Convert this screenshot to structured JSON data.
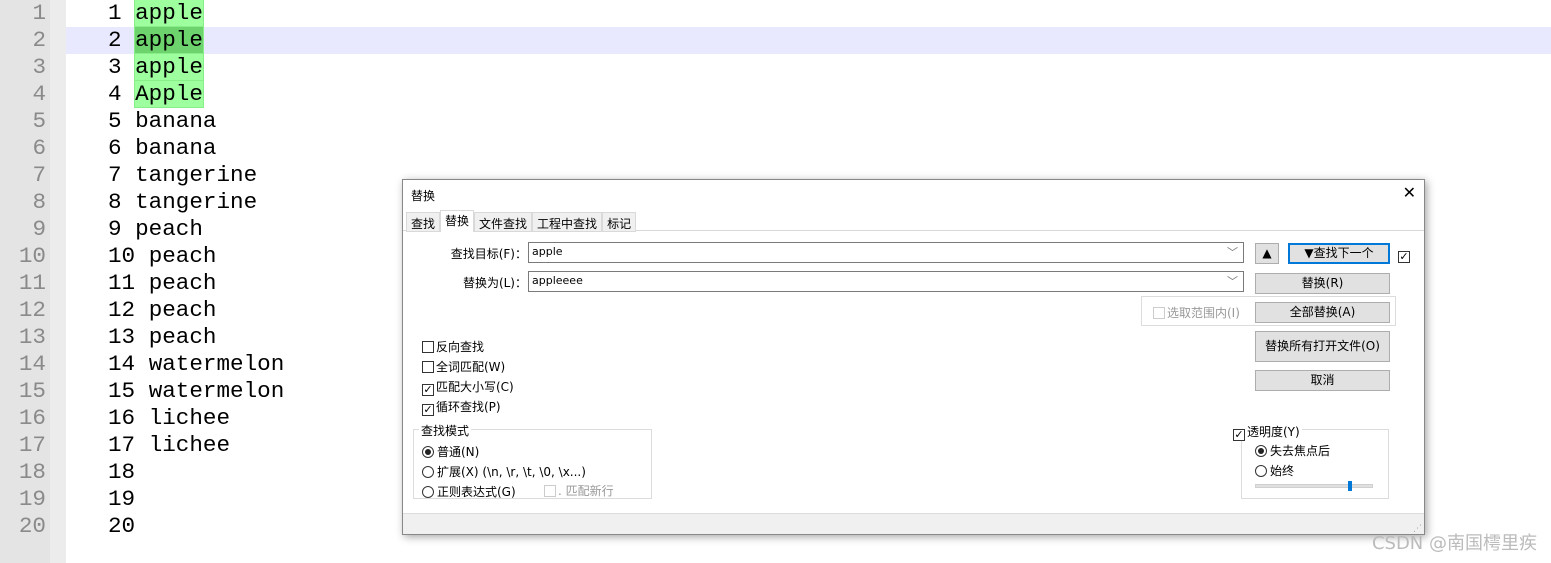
{
  "editor": {
    "lines": [
      {
        "n": "1",
        "num": "1",
        "word": "apple",
        "match": true
      },
      {
        "n": "2",
        "num": "2",
        "word": "apple",
        "match": true,
        "current": true
      },
      {
        "n": "3",
        "num": "3",
        "word": "apple",
        "match": true
      },
      {
        "n": "4",
        "num": "4",
        "word": "Apple",
        "match": true
      },
      {
        "n": "5",
        "num": "5",
        "word": "banana"
      },
      {
        "n": "6",
        "num": "6",
        "word": "banana"
      },
      {
        "n": "7",
        "num": "7",
        "word": "tangerine"
      },
      {
        "n": "8",
        "num": "8",
        "word": "tangerine"
      },
      {
        "n": "9",
        "num": "9",
        "word": "peach"
      },
      {
        "n": "10",
        "num": "10",
        "word": "peach"
      },
      {
        "n": "11",
        "num": "11",
        "word": "peach"
      },
      {
        "n": "12",
        "num": "12",
        "word": "peach"
      },
      {
        "n": "13",
        "num": "13",
        "word": "peach"
      },
      {
        "n": "14",
        "num": "14",
        "word": "watermelon"
      },
      {
        "n": "15",
        "num": "15",
        "word": "watermelon"
      },
      {
        "n": "16",
        "num": "16",
        "word": "lichee"
      },
      {
        "n": "17",
        "num": "17",
        "word": "lichee"
      },
      {
        "n": "18",
        "num": "18",
        "word": ""
      },
      {
        "n": "19",
        "num": "19",
        "word": ""
      },
      {
        "n": "20",
        "num": "20",
        "word": ""
      }
    ]
  },
  "dialog": {
    "title": "替换",
    "close_icon": "close-icon",
    "tabs": [
      {
        "label": "查找"
      },
      {
        "label": "替换",
        "active": true
      },
      {
        "label": "文件查找"
      },
      {
        "label": "工程中查找"
      },
      {
        "label": "标记"
      }
    ],
    "find_label": "查找目标(F)：",
    "find_value": "apple",
    "replace_label": "替换为(L)：",
    "replace_value": "appleeee",
    "prev_button": "▲",
    "find_next_button": "▼查找下一个",
    "find_next_checked": true,
    "replace_button": "替换(R)",
    "in_selection": "选取范围内(I)",
    "replace_all_button": "全部替换(A)",
    "replace_all_open_button": "替换所有打开文件(O)",
    "cancel_button": "取消",
    "options": [
      {
        "label": "反向查找",
        "checked": false
      },
      {
        "label": "全词匹配(W)",
        "checked": false
      },
      {
        "label": "匹配大小写(C)",
        "checked": true
      },
      {
        "label": "循环查找(P)",
        "checked": true
      }
    ],
    "mode_title": "查找模式",
    "modes": [
      {
        "label": "普通(N)",
        "selected": true
      },
      {
        "label": "扩展(X) (\\n, \\r, \\t, \\0, \\x...)",
        "selected": false
      },
      {
        "label": "正则表达式(G)",
        "selected": false
      }
    ],
    "dot_newline": ". 匹配新行",
    "transparency_label": "透明度(Y)",
    "transparency_checked": true,
    "trans_modes": [
      {
        "label": "失去焦点后",
        "selected": true
      },
      {
        "label": "始终",
        "selected": false
      }
    ],
    "transparency_level": 0.8,
    "accent": "#0078d7"
  },
  "watermark": "CSDN @南国樗里疾"
}
